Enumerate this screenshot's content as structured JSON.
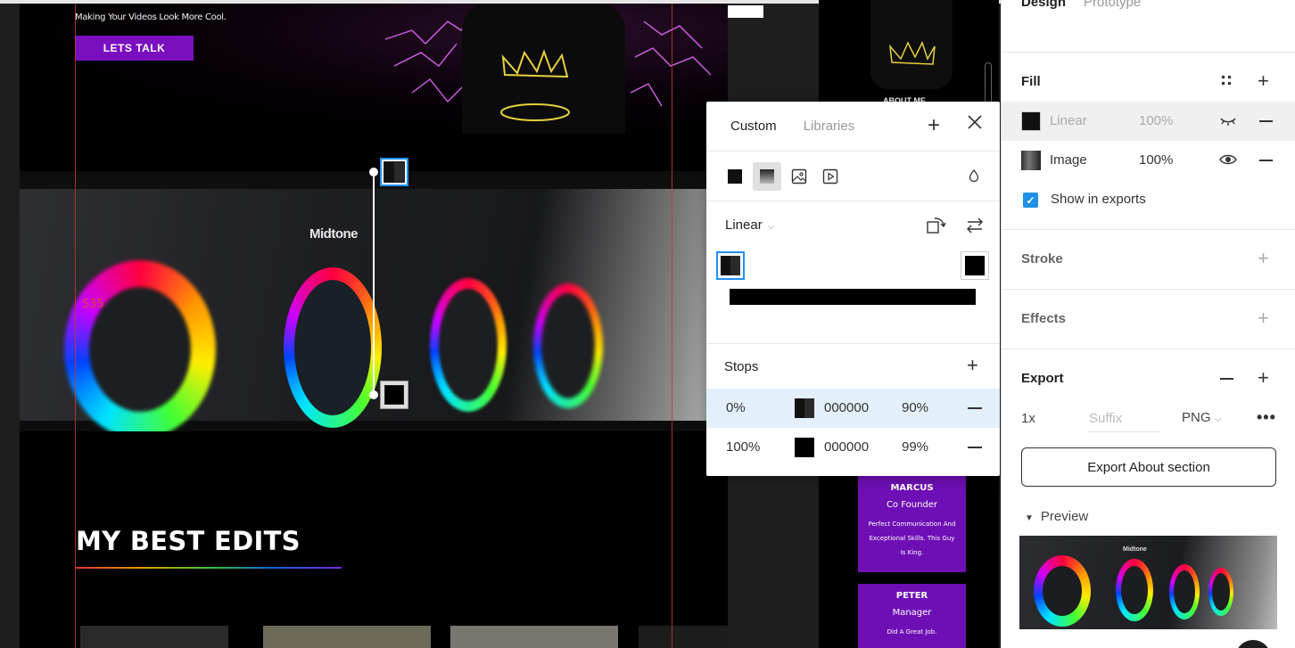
{
  "canvas": {
    "hero": {
      "tagline": "Making Your Videos Look More Cool.",
      "cta_label": "LETS TALK"
    },
    "photo": {
      "midtone_label": "Midtone",
      "selected_value": "535"
    },
    "section_title": "MY BEST EDITS",
    "side": {
      "about_label": "ABOUT ME",
      "cards": [
        {
          "name": "MARCUS",
          "role": "Co Founder",
          "desc": "Perfect Communication And Exceptional Skills. This Guy Is King."
        },
        {
          "name": "PETER",
          "role": "Manager",
          "desc": "Did A Great Job."
        }
      ]
    }
  },
  "picker": {
    "tabs": [
      "Custom",
      "Libraries"
    ],
    "active_tab": "Custom",
    "paint_types": [
      "solid-icon",
      "gradient-icon",
      "image-icon",
      "video-icon"
    ],
    "selected_type": "gradient-icon",
    "mode": "Linear",
    "stops_title": "Stops",
    "stops": [
      {
        "position": "0%",
        "hex": "000000",
        "opacity": "90%",
        "color": "#111111"
      },
      {
        "position": "100%",
        "hex": "000000",
        "opacity": "99%",
        "color": "#000000"
      }
    ]
  },
  "panel": {
    "tabs": [
      "Design",
      "Prototype"
    ],
    "active_tab": "Design",
    "fill": {
      "title": "Fill",
      "layers": [
        {
          "name": "Linear",
          "opacity": "100%",
          "visible": false
        },
        {
          "name": "Image",
          "opacity": "100%",
          "visible": true
        }
      ],
      "show_in_exports_label": "Show in exports",
      "show_in_exports_checked": true
    },
    "stroke_title": "Stroke",
    "effects_title": "Effects",
    "export": {
      "title": "Export",
      "scale": "1x",
      "suffix_placeholder": "Suffix",
      "format": "PNG",
      "button_label": "Export About section",
      "preview_label": "Preview",
      "preview_midtone": "Midtone"
    }
  },
  "colors": {
    "accent_purple": "#7a0fbf",
    "selection_blue": "#1e90ff",
    "guide_red": "#c0392b"
  }
}
